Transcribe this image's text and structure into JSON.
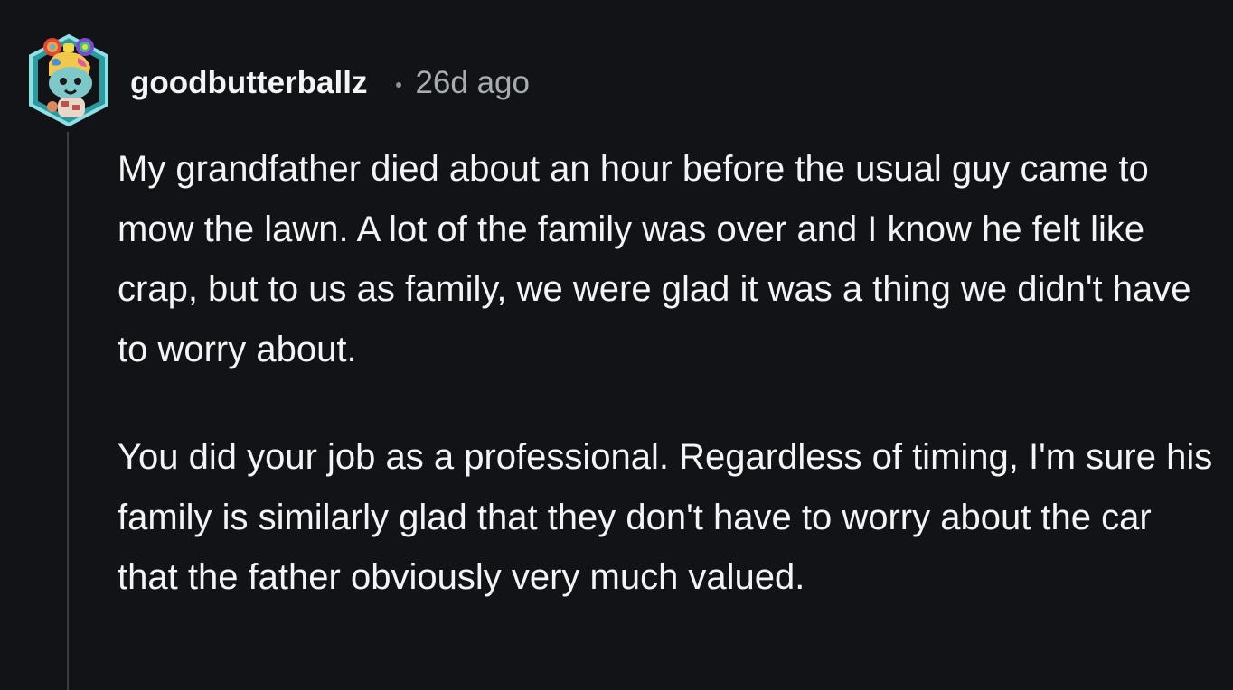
{
  "comment": {
    "author": "goodbutterballz",
    "time_ago": "26d ago",
    "paragraphs": [
      "My grandfather died about an hour before the usual guy came to mow the lawn. A lot of the family was over and I know he felt like crap, but to us as family, we were glad it was a thing we didn't have to worry about.",
      "You did your job as a professional. Regardless of timing, I'm sure his family is similarly glad that they don't have to worry about the car that the father obviously very much valued."
    ]
  },
  "avatar": {
    "icon": "snoo-avatar-with-rainbow-bow-icon"
  },
  "colors": {
    "background": "#111316",
    "text": "#f2f4f5",
    "muted": "#a6acb0",
    "thread_line": "#3a3d41"
  }
}
